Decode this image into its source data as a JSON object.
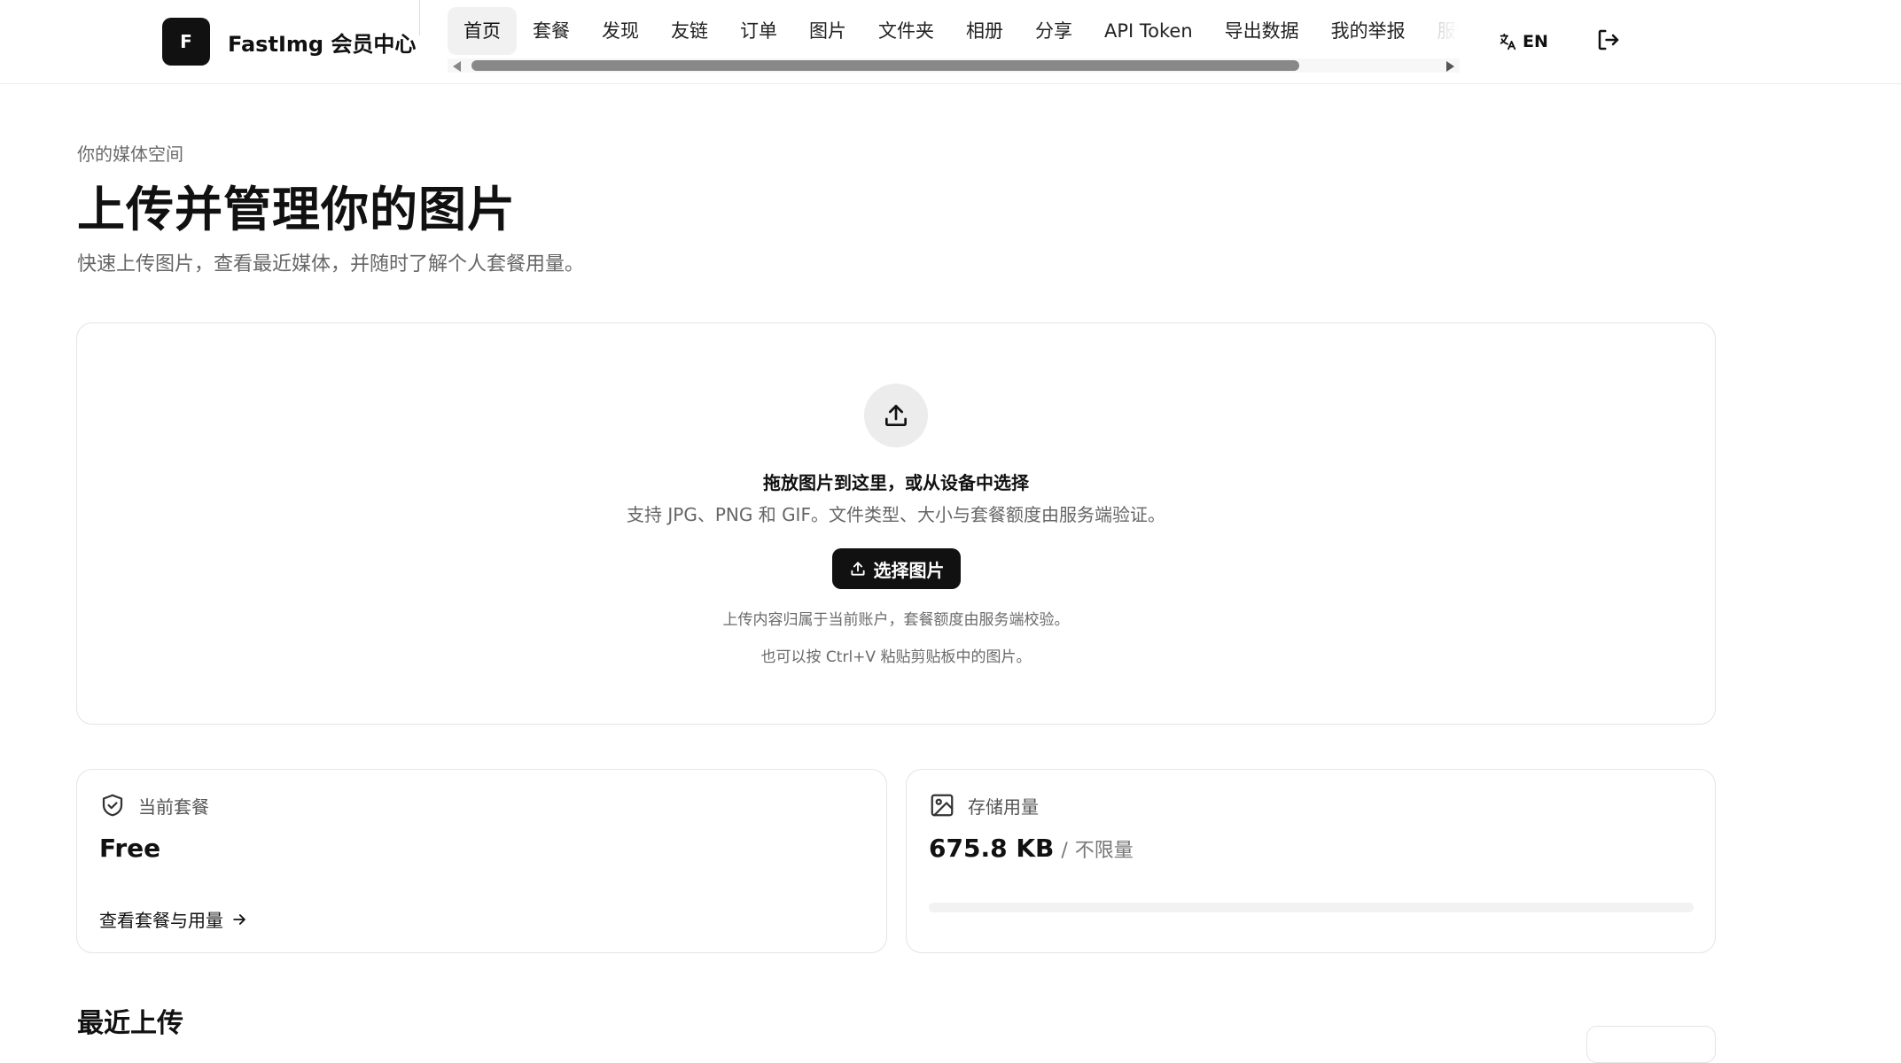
{
  "brand": {
    "logo_letter": "F",
    "name": "FastImg 会员中心"
  },
  "nav": {
    "items": [
      {
        "label": "首页",
        "active": true
      },
      {
        "label": "套餐",
        "active": false
      },
      {
        "label": "发现",
        "active": false
      },
      {
        "label": "友链",
        "active": false
      },
      {
        "label": "订单",
        "active": false
      },
      {
        "label": "图片",
        "active": false
      },
      {
        "label": "文件夹",
        "active": false
      },
      {
        "label": "相册",
        "active": false
      },
      {
        "label": "分享",
        "active": false
      },
      {
        "label": "API Token",
        "active": false
      },
      {
        "label": "导出数据",
        "active": false
      },
      {
        "label": "我的举报",
        "active": false
      },
      {
        "label": "服务",
        "active": false
      }
    ],
    "scroll_position": 0.0
  },
  "header_actions": {
    "language_label": "EN",
    "language_icon": "translate-icon",
    "logout_icon": "logout-icon"
  },
  "page": {
    "eyebrow": "你的媒体空间",
    "title": "上传并管理你的图片",
    "subtitle": "快速上传图片，查看最近媒体，并随时了解个人套餐用量。"
  },
  "upload": {
    "icon": "upload-icon",
    "heading": "拖放图片到这里，或从设备中选择",
    "description": "支持 JPG、PNG 和 GIF。文件类型、大小与套餐额度由服务端验证。",
    "button_label": "选择图片",
    "note_ownership": "上传内容归属于当前账户，套餐额度由服务端校验。",
    "note_paste": "也可以按 Ctrl+V 粘贴剪贴板中的图片。"
  },
  "plan_card": {
    "icon": "shield-check-icon",
    "label": "当前套餐",
    "value": "Free",
    "link_label": "查看套餐与用量",
    "link_icon": "arrow-right-icon"
  },
  "storage_card": {
    "icon": "image-icon",
    "label": "存储用量",
    "used": "675.8 KB",
    "separator": "/",
    "limit": "不限量",
    "progress": 0.0
  },
  "recent": {
    "title": "最近上传"
  },
  "colors": {
    "primary": "#111111",
    "muted_text": "#666666",
    "border": "#e4e4e4",
    "active_nav_bg": "#f1f1f1",
    "icon_circle_bg": "#ececec"
  }
}
